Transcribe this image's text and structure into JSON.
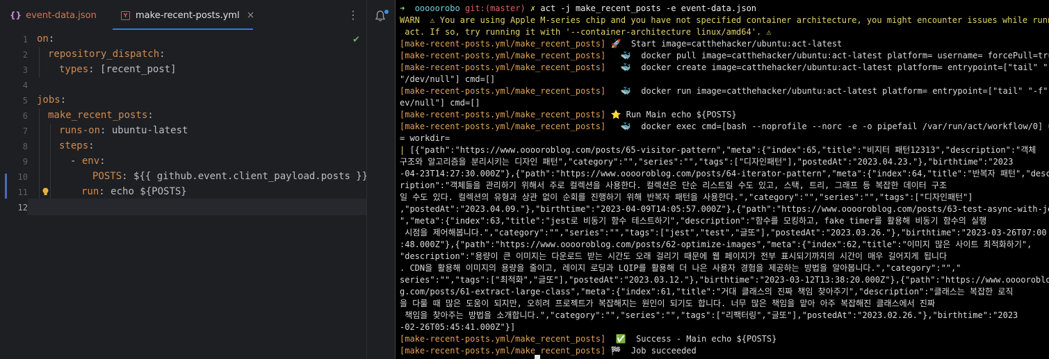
{
  "editor": {
    "tabs": [
      {
        "icon": "{}",
        "label": "event-data.json",
        "active": false
      },
      {
        "icon": "Y",
        "label": "make-recent-posts.yml",
        "active": true,
        "close": "×"
      }
    ],
    "menu_glyph": "⋮",
    "line_numbers": [
      "1",
      "2",
      "3",
      "4",
      "5",
      "6",
      "7",
      "8",
      "9",
      "10",
      "11",
      "12"
    ],
    "code": {
      "l1_key": "on",
      "l1_colon": ":",
      "l2_key": "repository_dispatch",
      "l2_colon": ":",
      "l3_key": "types",
      "l3_val": ": [recent_post]",
      "l5_key": "jobs",
      "l5_colon": ":",
      "l6_key": "make_recent_posts",
      "l6_colon": ":",
      "l7_key": "runs-on",
      "l7_val": ": ubuntu-latest",
      "l8_key": "steps",
      "l8_colon": ":",
      "l9_dash": "- ",
      "l9_key": "env",
      "l9_colon": ":",
      "l10_key": "POSTS",
      "l10_val": ": ${{ github.event.client_payload.posts }}",
      "l11_key": "run",
      "l11_val": ": echo ${POSTS}"
    }
  },
  "terminal": {
    "prompt_arrow": "➜",
    "prompt_dir": "ooooorobo",
    "prompt_git": "git:(",
    "prompt_branch": "master",
    "prompt_git_close": ")",
    "prompt_x": "✗",
    "command": "act -j make_recent_posts -e event-data.json",
    "warn_label": "WARN",
    "warn_text1": "  ⚠ You are using Apple M-series chip and you have not specified container architecture, you might encounter issues while running",
    "warn_text2": " act. If so, try running it with '--container-architecture linux/amd64'. ⚠",
    "job_tag": "[make-recent-posts.yml/make_recent_posts]",
    "l_start": " 🚀  Start image=catthehacker/ubuntu:act-latest",
    "l_pull": "   🐳  docker pull image=catthehacker/ubuntu:act-latest platform= username= forcePull=true",
    "l_create1": "   🐳  docker create image=catthehacker/ubuntu:act-latest platform= entrypoint=[\"tail\" \"-f\"",
    "l_create2": "\"/dev/null\"] cmd=[]",
    "l_run1": "   🐳  docker run image=catthehacker/ubuntu:act-latest platform= entrypoint=[\"tail\" \"-f\" \"/d",
    "l_run2": "ev/null\"] cmd=[]",
    "l_main": " ⭐ Run Main echo ${POSTS}",
    "l_exec1": "   🐳  docker exec cmd=[bash --noprofile --norc -e -o pipefail /var/run/act/workflow/0] user",
    "l_exec2": "= workdir=",
    "out_bar": "|",
    "out": [
      " [{\"path\":\"https://www.ooooroblog.com/posts/65-visitor-pattern\",\"meta\":{\"index\":65,\"title\":\"비지터 패턴12313\",\"description\":\"객체",
      "구조와 알고리즘을 분리시키는 디자인 패턴\",\"category\":\"\",\"series\":\"\",\"tags\":[\"디자인패턴\"],\"postedAt\":\"2023.04.23.\"},\"birthtime\":\"2023",
      "-04-23T14:27:30.000Z\"},{\"path\":\"https://www.ooooroblog.com/posts/64-iterator-pattern\",\"meta\":{\"index\":64,\"title\":\"반복자 패턴\",\"desc",
      "ription\":\"객체들을 관리하기 위해서 주로 컬렉션을 사용한다. 컬렉션은 단순 리스트일 수도 있고, 스택, 트리, 그래프 등 복잡한 데이터 구조",
      "일 수도 있다. 컬렉션의 유형과 상관 없이 순회를 진행하기 위해 반복자 패턴을 사용한다.\",\"category\":\"\",\"series\":\"\",\"tags\":[\"디자인패턴\"]",
      ",\"postedAt\":\"2023.04.09.\"},\"birthtime\":\"2023-04-09T14:05:57.000Z\"},{\"path\":\"https://www.ooooroblog.com/posts/63-test-async-with-jest",
      "\",\"meta\":{\"index\":63,\"title\":\"jest로 비동기 함수 테스트하기\",\"description\":\"함수를 모킹하고, fake timer를 활용해 비동기 함수의 실행",
      " 시점을 제어해봅니다.\",\"category\":\"\",\"series\":\"\",\"tags\":[\"jest\",\"test\",\"글또\"],\"postedAt\":\"2023.03.26.\"},\"birthtime\":\"2023-03-26T07:00",
      ":48.000Z\"},{\"path\":\"https://www.ooooroblog.com/posts/62-optimize-images\",\"meta\":{\"index\":62,\"title\":\"이미지 많은 사이트 최적화하기\",",
      "\"description\":\"용량이 큰 이미지는 다운로드 받는 시간도 오래 걸리기 때문에 웹 페이지가 전부 표시되기까지의 시간이 매우 길어지게 됩니다",
      ". CDN을 활용해 이미지의 용량을 줄이고, 레이지 로딩과 LQIP를 활용해 더 나은 사용자 경험을 제공하는 방법을 알아봅니다.\",\"category\":\"\",\"",
      "series\":\"\",\"tags\":[\"최적화\",\"글또\"],\"postedAt\":\"2023.03.12.\"},\"birthtime\":\"2023-03-12T13:38:20.000Z\"},{\"path\":\"https://www.ooooroblo",
      "g.com/posts/61-extract-large-class\",\"meta\":{\"index\":61,\"title\":\"거대 클래스의 진짜 책임 찾아주기\",\"description\":\"클래스는 복잡한 로직",
      "을 다룰 때 많은 도움이 되지만, 오히려 프로젝트가 복잡해지는 원인이 되기도 합니다. 너무 많은 책임을 맡아 아주 복잡해진 클래스에서 진짜",
      " 책임을 찾아주는 방법을 소개합니다.\",\"category\":\"\",\"series\":\"\",\"tags\":[\"리팩터링\",\"글또\"],\"postedAt\":\"2023.02.26.\"},\"birthtime\":\"2023",
      "-02-26T05:45:41.000Z\"}]"
    ],
    "l_success": "  ✅  Success - Main echo ${POSTS}",
    "l_job": " 🏁  Job succeeded"
  }
}
